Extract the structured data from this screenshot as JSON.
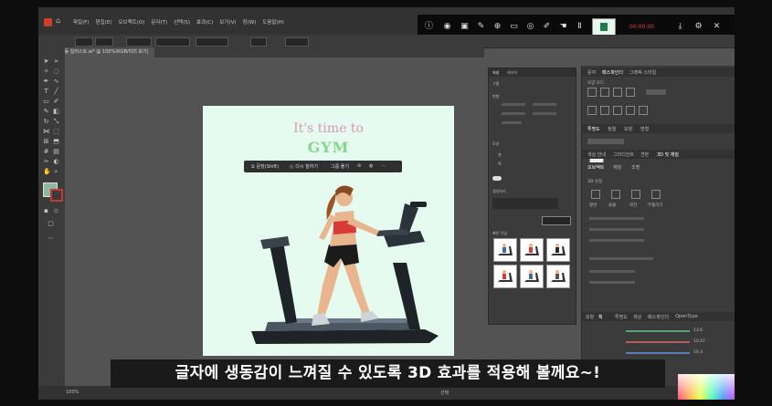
{
  "app": {
    "menus": [
      "파일(F)",
      "편집(E)",
      "오브젝트(O)",
      "문자(T)",
      "선택(S)",
      "효과(C)",
      "보기(V)",
      "창(W)",
      "도움말(H)"
    ],
    "document_tab": "운동 일러스트.ai* @ 100%(RGB/미리 보기)",
    "zoom": "100%",
    "recording_time": "00:00:00"
  },
  "artboard": {
    "headline_line1": "It's time to",
    "headline_line2": "GYM"
  },
  "context_bar": {
    "items": [
      "문장(Shift)",
      "다시 칠하기",
      "그룹 풀기"
    ]
  },
  "properties_panel": {
    "tab1": "속성",
    "tab2": "레이어",
    "tab3": "라이브러리",
    "label_group": "그룹",
    "label_transform": "변형",
    "label_appearance": "모양",
    "label_quick": "빠른 작업",
    "label_generate": "생성하기",
    "field_fill": "칠",
    "field_stroke": "획"
  },
  "right_panel": {
    "tabs_row1": [
      "문자",
      "패스파인더",
      "그래픽 스타일"
    ],
    "tabs_row2": [
      "투명도",
      "정렬",
      "모양",
      "변형"
    ],
    "tabs_row3": [
      "색상 안내",
      "그라디언트",
      "견본",
      "3D 및 재질"
    ],
    "tabs_row4": [
      "오브젝트",
      "재질",
      "조명"
    ],
    "section_3d": "3D 유형",
    "types": [
      "평면",
      "돌출",
      "회전",
      "부풀리기"
    ],
    "tabs_bottom": [
      "모양",
      "획",
      "투명도",
      "색상",
      "패스파인더",
      "OpenType"
    ],
    "value_1": "13.6",
    "value_2": "10.47",
    "value_3": "10.3"
  },
  "statusbar": {
    "zoom": "100%",
    "tool": "선택"
  },
  "subtitle": "글자에 생동감이 느껴질 수 있도록 3D 효과를 적용해 볼께요~!",
  "colors": {
    "workspace": "#535353",
    "panel": "#3b3b3b",
    "artboard": "#e5fbf0",
    "headline_pink": "#d898b4",
    "headline_green": "#86d68f"
  }
}
